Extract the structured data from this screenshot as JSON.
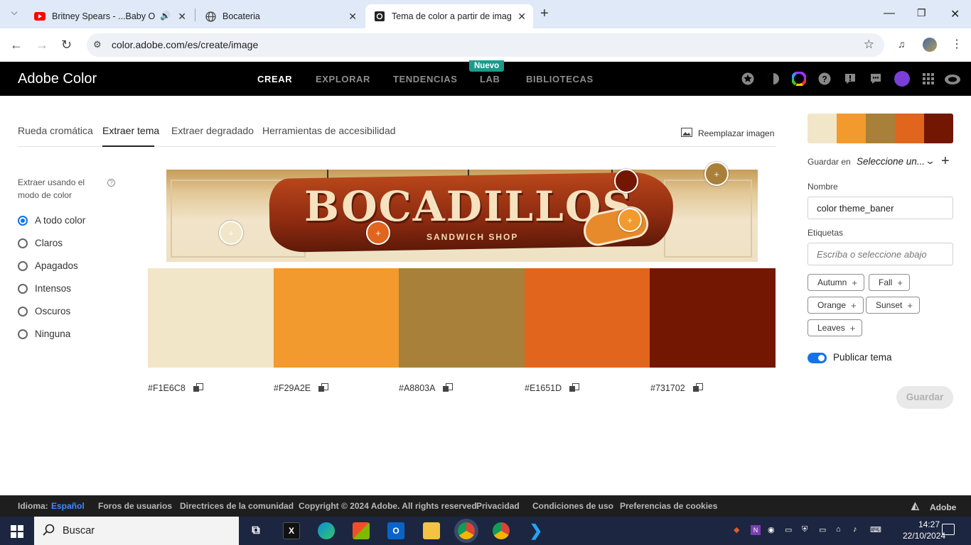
{
  "browser": {
    "tabs": [
      {
        "title": "Britney Spears - ...Baby One More Time",
        "icon": "youtube-icon"
      },
      {
        "title": "Bocateria",
        "icon": "globe-icon"
      },
      {
        "title": "Tema de color a partir de imagen",
        "icon": "adobe-color-icon"
      }
    ],
    "url": "color.adobe.com/es/create/image"
  },
  "header": {
    "brand": "Adobe Color",
    "nav": [
      "CREAR",
      "EXPLORAR",
      "TENDENCIAS",
      "LAB",
      "BIBLIOTECAS"
    ],
    "badge": "Nuevo"
  },
  "subtabs": [
    "Rueda cromática",
    "Extraer tema",
    "Extraer degradado",
    "Herramientas de accesibilidad"
  ],
  "replace_image": "Reemplazar imagen",
  "mode": {
    "label": "Extraer usando el modo de color",
    "options": [
      "A todo color",
      "Claros",
      "Apagados",
      "Intensos",
      "Oscuros",
      "Ninguna"
    ],
    "selected": "A todo color"
  },
  "image": {
    "title": "BOCADILLOS",
    "subtitle": "SANDWICH SHOP"
  },
  "swatches": [
    {
      "hex": "#F1E6C8",
      "color": "#f1e6c8"
    },
    {
      "hex": "#F29A2E",
      "color": "#f29a2e"
    },
    {
      "hex": "#A8803A",
      "color": "#a8803a"
    },
    {
      "hex": "#E1651D",
      "color": "#e1651d"
    },
    {
      "hex": "#731702",
      "color": "#731702"
    }
  ],
  "panel": {
    "save_in_label": "Guardar en",
    "save_in_value": "Seleccione un...",
    "name_label": "Nombre",
    "name_value": "color theme_baner",
    "tags_label": "Etiquetas",
    "tags_placeholder": "Escriba o seleccione abajo",
    "tags": [
      "Autumn",
      "Fall",
      "Orange",
      "Sunset",
      "Leaves"
    ],
    "publish_label": "Publicar tema",
    "publish_on": true,
    "save_button": "Guardar"
  },
  "footer": {
    "lang_label": "Idioma:",
    "lang_value": "Español",
    "links": [
      "Foros de usuarios",
      "Directrices de la comunidad",
      "Copyright © 2024 Adobe. All rights reserved.",
      "Privacidad",
      "Condiciones de uso",
      "Preferencias de cookies"
    ],
    "adobe": "Adobe"
  },
  "taskbar": {
    "search": "Buscar",
    "time": "14:27",
    "date": "22/10/2024"
  }
}
